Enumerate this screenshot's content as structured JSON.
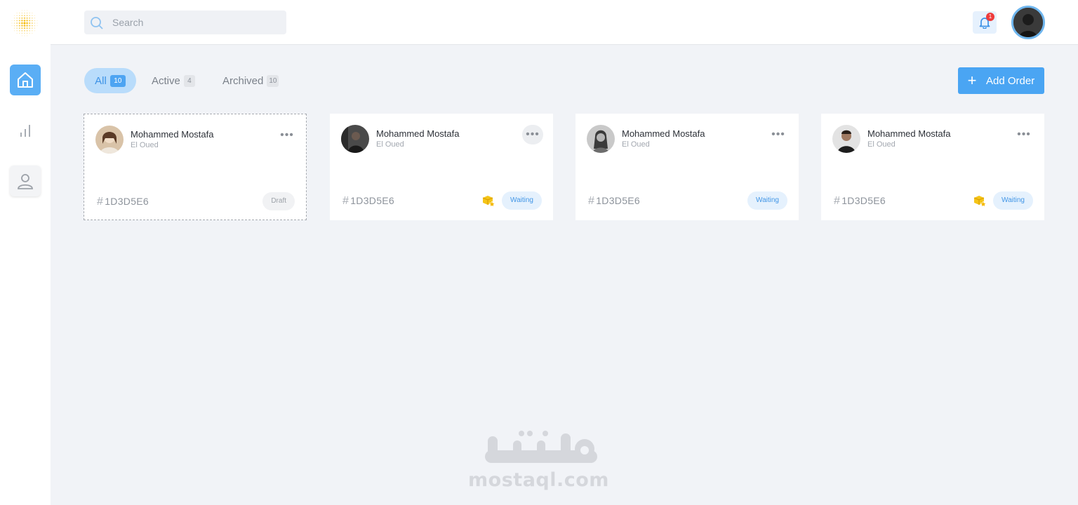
{
  "search": {
    "placeholder": "Search",
    "value": ""
  },
  "notifications": {
    "count": "1"
  },
  "tabs": [
    {
      "label": "All",
      "count": "10",
      "selected": true
    },
    {
      "label": "Active",
      "count": "4",
      "selected": false
    },
    {
      "label": "Archived",
      "count": "10",
      "selected": false
    }
  ],
  "add_order": {
    "label": "Add Order"
  },
  "orders": [
    {
      "name": "Mohammed Mostafa",
      "location": "El Oued",
      "id": "1D3D5E6",
      "status": "Draft",
      "has_box_icon": false
    },
    {
      "name": "Mohammed Mostafa",
      "location": "El Oued",
      "id": "1D3D5E6",
      "status": "Waiting",
      "has_box_icon": true
    },
    {
      "name": "Mohammed Mostafa",
      "location": "El Oued",
      "id": "1D3D5E6",
      "status": "Waiting",
      "has_box_icon": false
    },
    {
      "name": "Mohammed Mostafa",
      "location": "El Oued",
      "id": "1D3D5E6",
      "status": "Waiting",
      "has_box_icon": true
    }
  ],
  "watermark": {
    "text": "mostaql.com"
  },
  "colors": {
    "accent": "#4aa5f3",
    "accent_light": "#b9dcfb",
    "badge": "#ee3b3b",
    "logo": "#f5b800"
  },
  "icons": [
    "sun-logo-icon",
    "home-icon",
    "bar-chart-icon",
    "user-icon",
    "search-icon",
    "bell-icon",
    "plus-icon",
    "more-dots-icon",
    "hash-icon",
    "box-star-icon"
  ]
}
